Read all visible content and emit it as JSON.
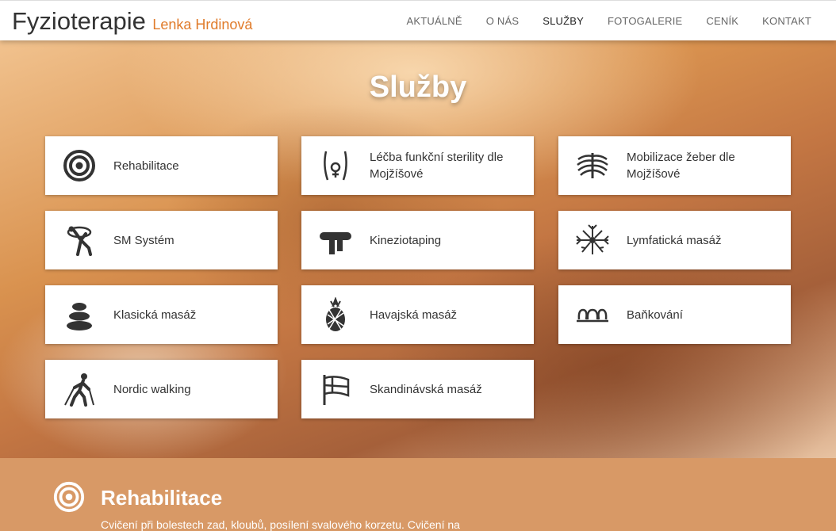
{
  "header": {
    "brand_main": "Fyzioterapie",
    "brand_sub": "Lenka Hrdinová",
    "nav": [
      {
        "label": "AKTUÁLNĚ"
      },
      {
        "label": "O NÁS"
      },
      {
        "label": "SLUŽBY"
      },
      {
        "label": "FOTOGALERIE"
      },
      {
        "label": "CENÍK"
      },
      {
        "label": "KONTAKT"
      }
    ],
    "active_nav": "SLUŽBY"
  },
  "hero": {
    "title": "Služby"
  },
  "services": [
    {
      "label": "Rehabilitace",
      "icon": "target-icon"
    },
    {
      "label": "Léčba funkční sterility dle Mojžíšové",
      "icon": "female-pelvis-icon"
    },
    {
      "label": "Mobilizace žeber dle Mojžíšové",
      "icon": "ribcage-icon"
    },
    {
      "label": "SM Systém",
      "icon": "stretching-figure-icon"
    },
    {
      "label": "Kineziotaping",
      "icon": "tape-icon"
    },
    {
      "label": "Lymfatická masáž",
      "icon": "lymph-node-icon"
    },
    {
      "label": "Klasická masáž",
      "icon": "stones-icon"
    },
    {
      "label": "Havajská masáž",
      "icon": "pineapple-icon"
    },
    {
      "label": "Baňkování",
      "icon": "cups-icon"
    },
    {
      "label": "Nordic walking",
      "icon": "nordic-walker-icon"
    },
    {
      "label": "Skandinávská masáž",
      "icon": "scandinavian-flag-icon"
    }
  ],
  "section": {
    "title": "Rehabilitace",
    "text": "Cvičení při bolestech zad, kloubů, posílení svalového korzetu. Cvičení na",
    "icon": "target-icon"
  },
  "colors": {
    "accent": "#e07b2a",
    "section_bg": "#d89966"
  }
}
